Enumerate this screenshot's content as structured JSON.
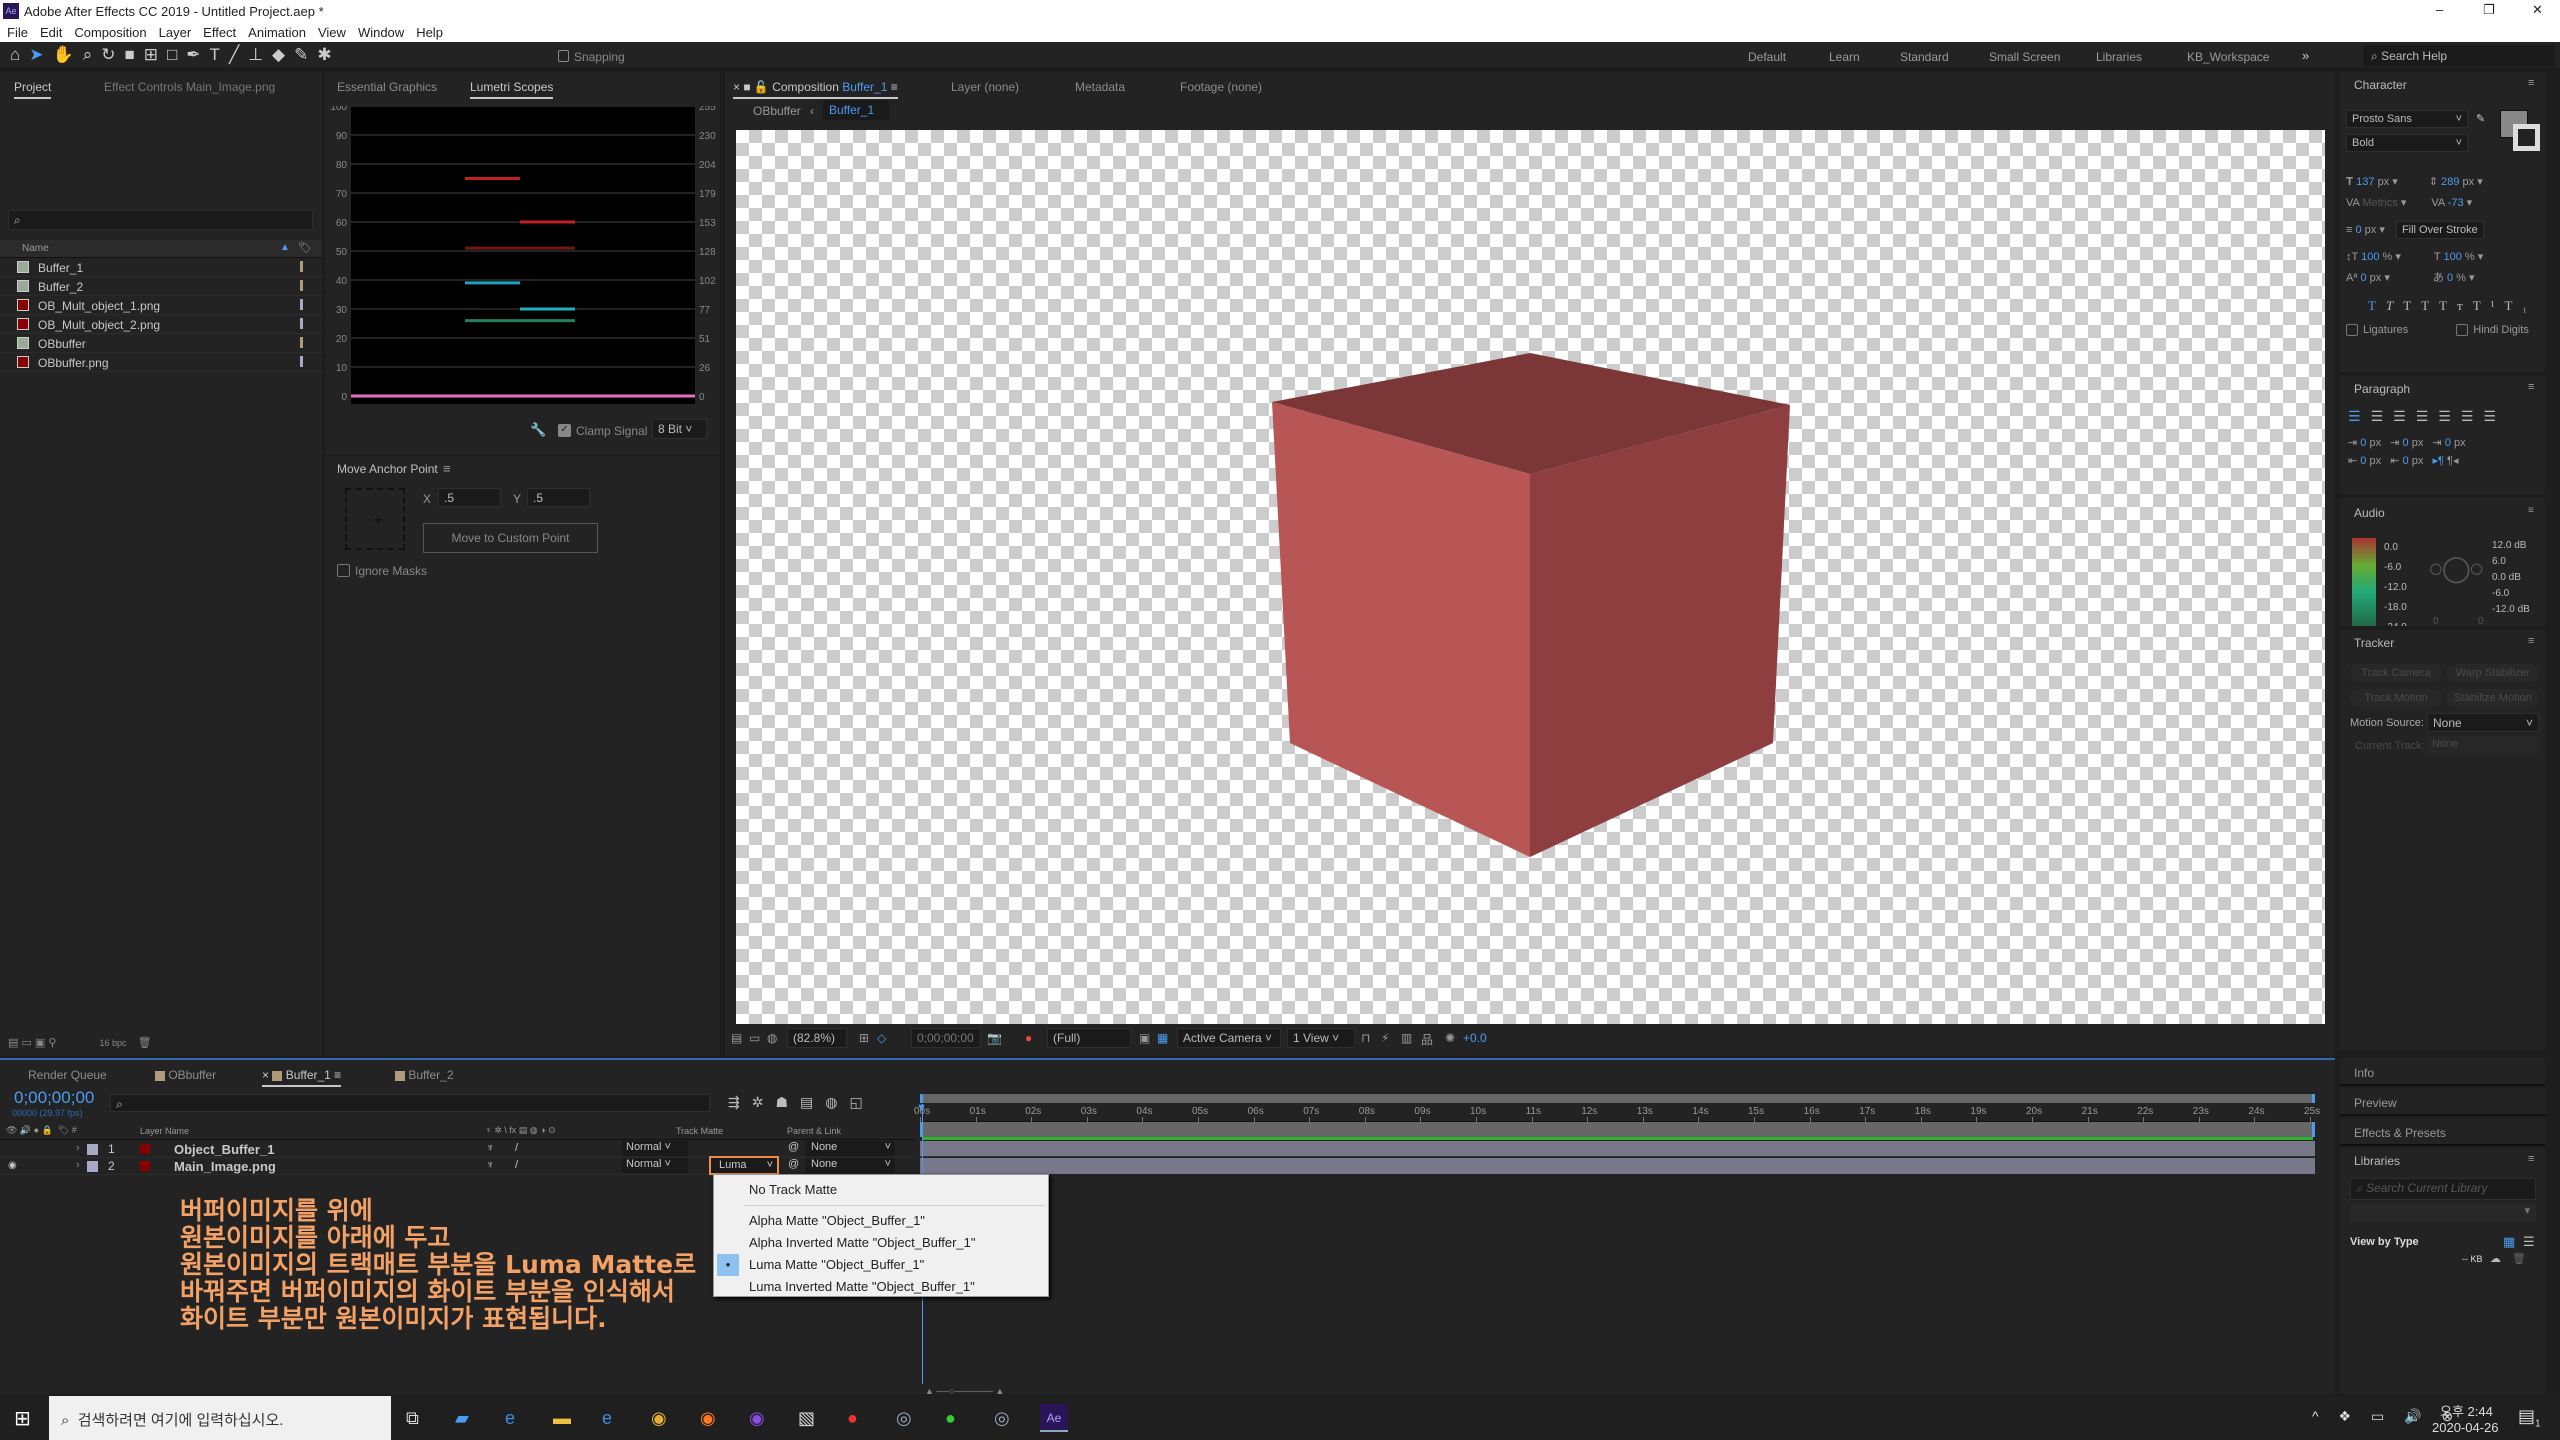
{
  "window": {
    "title": "Adobe After Effects CC 2019 - Untitled Project.aep *",
    "app_icon": "Ae",
    "controls": [
      "–",
      "❐",
      "✕"
    ]
  },
  "menu": [
    "File",
    "Edit",
    "Composition",
    "Layer",
    "Effect",
    "Animation",
    "View",
    "Window",
    "Help"
  ],
  "toolbar": {
    "snapping": "Snapping",
    "workspaces": [
      "Default",
      "Learn",
      "Standard",
      "Small Screen",
      "Libraries",
      "KB_Workspace"
    ],
    "search_help": "Search Help"
  },
  "project": {
    "tab": "Project",
    "effect_controls_tab": "Effect Controls Main_Image.png",
    "col_name": "Name",
    "items": [
      {
        "name": "Buffer_1",
        "type": "comp"
      },
      {
        "name": "Buffer_2",
        "type": "comp"
      },
      {
        "name": "OB_Mult_object_1.png",
        "type": "image"
      },
      {
        "name": "OB_Mult_object_2.png",
        "type": "image"
      },
      {
        "name": "OBbuffer",
        "type": "comp"
      },
      {
        "name": "OBbuffer.png",
        "type": "image"
      }
    ],
    "bpc": "16 bpc"
  },
  "scopes": {
    "tab_essential": "Essential Graphics",
    "tab_lumetri": "Lumetri Scopes",
    "left_ticks": [
      "100",
      "90",
      "80",
      "70",
      "60",
      "50",
      "40",
      "30",
      "20",
      "10",
      "0"
    ],
    "right_ticks": [
      "255",
      "230",
      "204",
      "179",
      "153",
      "128",
      "102",
      "77",
      "51",
      "26",
      "0"
    ],
    "clamp_signal": "Clamp Signal",
    "bit_depth": "8 Bit"
  },
  "anchor": {
    "title": "Move Anchor Point",
    "x_label": "X",
    "x_value": ".5",
    "y_label": "Y",
    "y_value": ".5",
    "button": "Move to Custom Point",
    "ignore_masks": "Ignore Masks"
  },
  "comp": {
    "tab": "Composition",
    "tab_comp_name": "Buffer_1",
    "tab_layer": "Layer (none)",
    "tab_metadata": "Metadata",
    "tab_footage": "Footage (none)",
    "crumb_parent": "OBbuffer",
    "crumb_current": "Buffer_1",
    "zoom": "(82.8%)",
    "timecode": "0;00;00;00",
    "resolution": "(Full)",
    "camera": "Active Camera",
    "views": "1 View",
    "exposure": "+0.0",
    "cube_colors": {
      "top": "#7b3637",
      "left": "#b85656",
      "right": "#8e3e3f"
    }
  },
  "character": {
    "title": "Character",
    "font": "Prosto Sans",
    "style": "Bold",
    "size": "137",
    "size_unit": "px",
    "leading": "289",
    "leading_unit": "px",
    "kerning": "Metrics",
    "tracking": "-73",
    "stroke": "0",
    "stroke_unit": "px",
    "stroke_mode": "Fill Over Stroke",
    "vscale": "100",
    "hscale": "100",
    "pct": "%",
    "baseline": "0",
    "baseline_unit": "px",
    "tsume": "0",
    "tsume_unit": "%",
    "ligatures": "Ligatures",
    "hindi": "Hindi Digits"
  },
  "paragraph": {
    "title": "Paragraph",
    "zero": "0",
    "px": "px"
  },
  "audio": {
    "title": "Audio",
    "left_scale": [
      "0.0",
      "-6.0",
      "-12.0",
      "-18.0",
      "-24.0"
    ],
    "right_scale": [
      "12.0 dB",
      "6.0",
      "0.0 dB",
      "-6.0",
      "-12.0 dB"
    ],
    "knob_values": [
      "0",
      "0"
    ]
  },
  "tracker": {
    "title": "Tracker",
    "buttons": [
      "Track Camera",
      "Warp Stabilizer",
      "Track Motion",
      "Stabilize Motion"
    ],
    "motion_source_label": "Motion Source:",
    "motion_source": "None",
    "current_track_label": "Current Track:",
    "current_track": "None"
  },
  "side_tabs": [
    "Info",
    "Preview",
    "Effects & Presets"
  ],
  "libraries": {
    "title": "Libraries",
    "search_placeholder": "Search Current Library",
    "view_by": "View by Type",
    "size": "-- KB"
  },
  "timeline": {
    "tabs": [
      {
        "label": "Render Queue"
      },
      {
        "label": "OBbuffer"
      },
      {
        "label": "Buffer_1"
      },
      {
        "label": "Buffer_2"
      }
    ],
    "timecode": "0;00;00;00",
    "fps": "00000 (29.97 fps)",
    "col_layer_name": "Layer Name",
    "col_track_matte": "Track Matte",
    "col_parent": "Parent & Link",
    "ticks": [
      "00s",
      "01s",
      "02s",
      "03s",
      "04s",
      "05s",
      "06s",
      "07s",
      "08s",
      "09s",
      "10s",
      "11s",
      "12s",
      "13s",
      "14s",
      "15s",
      "16s",
      "17s",
      "18s",
      "19s",
      "20s",
      "21s",
      "22s",
      "23s",
      "24s",
      "25s"
    ],
    "layers": [
      {
        "num": "1",
        "name": "Object_Buffer_1",
        "mode": "Normal",
        "matte": "",
        "parent": "None"
      },
      {
        "num": "2",
        "name": "Main_Image.png",
        "mode": "Normal",
        "matte": "Luma",
        "parent": "None"
      }
    ],
    "matte_menu": {
      "items": [
        "No Track Matte",
        "Alpha Matte \"Object_Buffer_1\"",
        "Alpha Inverted Matte \"Object_Buffer_1\"",
        "Luma Matte \"Object_Buffer_1\"",
        "Luma Inverted Matte \"Object_Buffer_1\""
      ],
      "selected": "Luma Matte \"Object_Buffer_1\""
    }
  },
  "annotation": {
    "lines": [
      "버퍼이미지를 위에",
      "원본이미지를 아래에 두고",
      "원본이미지의 트랙매트 부분을 Luma Matte로",
      "바꿔주면 버퍼이미지의 화이트 부분을 인식해서",
      "화이트 부분만 원본이미지가 표현됩니다."
    ],
    "color": "#f4a165",
    "highlight": "#f08c4a"
  },
  "taskbar": {
    "search_placeholder": "검색하려면 여기에 입력하십시오.",
    "time": "오후 2:44",
    "date": "2020-04-26",
    "notifications": "1"
  }
}
